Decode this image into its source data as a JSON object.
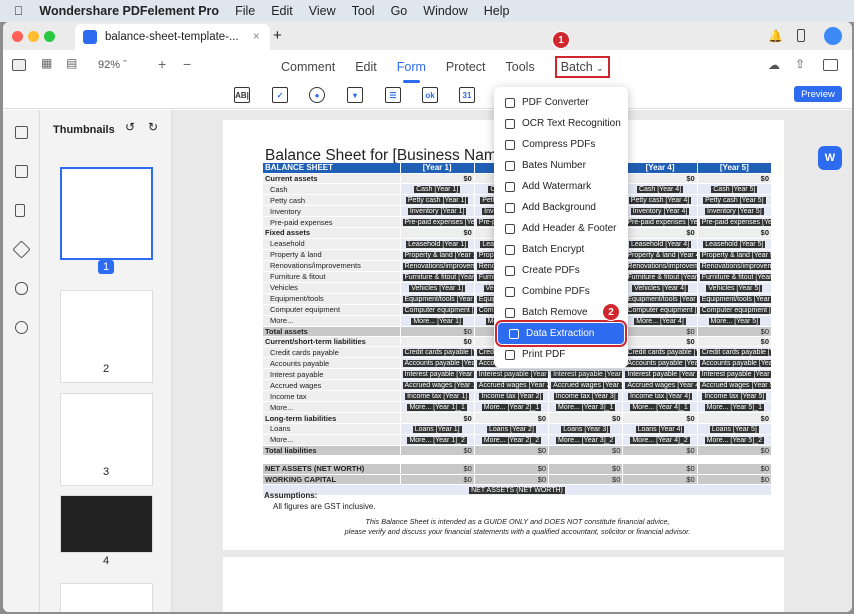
{
  "menubar": {
    "app": "Wondershare PDFelement Pro",
    "items": [
      "File",
      "Edit",
      "View",
      "Tool",
      "Go",
      "Window",
      "Help"
    ]
  },
  "tab": {
    "title": "balance-sheet-template-...",
    "close": "×",
    "new": "+"
  },
  "toolbar": {
    "zoom": "92%",
    "nav": [
      "Comment",
      "Edit",
      "Form",
      "Protect",
      "Tools"
    ],
    "batch": "Batch",
    "preview": "Preview",
    "form_tools": [
      "AB|",
      "✓",
      "●",
      "▾",
      "☰",
      "ok",
      "31"
    ]
  },
  "badges": [
    "1",
    "2"
  ],
  "thumbnails": {
    "title": "Thumbnails",
    "pages": [
      "1",
      "2",
      "3",
      "4"
    ]
  },
  "batch_menu": [
    "PDF Converter",
    "OCR Text Recognition",
    "Compress PDFs",
    "Bates Number",
    "Add Watermark",
    "Add Background",
    "Add Header & Footer",
    "Batch Encrypt",
    "Create PDFs",
    "Combine PDFs",
    "Batch Remove",
    "Data Extraction",
    "Print PDF"
  ],
  "selected_menu_item": "Data Extraction",
  "document": {
    "title": "Balance Sheet for [Business Name]",
    "headers": [
      "BALANCE SHEET",
      "[Year 1]",
      "[Year 2]",
      "[Year 3]",
      "[Year 4]",
      "[Year 5]"
    ],
    "rows": [
      {
        "t": "sec",
        "label": "Current assets",
        "v": "$0"
      },
      {
        "t": "item",
        "label": "Cash",
        "f": "Cash"
      },
      {
        "t": "item",
        "label": "Petty cash",
        "f": "Petty cash"
      },
      {
        "t": "item",
        "label": "Inventory",
        "f": "Inventory"
      },
      {
        "t": "item",
        "label": "Pre-paid expenses",
        "f": "Pre-paid expenses"
      },
      {
        "t": "sec",
        "label": "Fixed assets",
        "v": "$0"
      },
      {
        "t": "item",
        "label": "Leasehold",
        "f": "Leasehold"
      },
      {
        "t": "item",
        "label": "Property & land",
        "f": "Property & land"
      },
      {
        "t": "item",
        "label": "Renovations/improvements",
        "f": "Renovations/improvements"
      },
      {
        "t": "item",
        "label": "Furniture & fitout",
        "f": "Furniture & fitout"
      },
      {
        "t": "item",
        "label": "Vehicles",
        "f": "Vehicles"
      },
      {
        "t": "item",
        "label": "Equipment/tools",
        "f": "Equipment/tools"
      },
      {
        "t": "item",
        "label": "Computer equipment",
        "f": "Computer equipment"
      },
      {
        "t": "item",
        "label": "More...",
        "f": "More..."
      },
      {
        "t": "tot",
        "label": "Total assets",
        "v": "$0"
      },
      {
        "t": "sec",
        "label": "Current/short-term liabilities",
        "v": "$0"
      },
      {
        "t": "item",
        "label": "Credit cards payable",
        "f": "Credit cards payable"
      },
      {
        "t": "item",
        "label": "Accounts payable",
        "f": "Accounts payable"
      },
      {
        "t": "item",
        "label": "Interest payable",
        "f": "Interest payable"
      },
      {
        "t": "item",
        "label": "Accrued wages",
        "f": "Accrued wages"
      },
      {
        "t": "item",
        "label": "Income tax",
        "f": "Income tax"
      },
      {
        "t": "item",
        "label": "More...",
        "f": "More...",
        "s": "_1"
      },
      {
        "t": "sec",
        "label": "Long-term liabilities",
        "v": "$0"
      },
      {
        "t": "item",
        "label": "Loans",
        "f": "Loans"
      },
      {
        "t": "item",
        "label": "More...",
        "f": "More...",
        "s": "_2"
      },
      {
        "t": "tot",
        "label": "Total liabilities",
        "v": "$0"
      },
      {
        "t": "blank",
        "label": ""
      },
      {
        "t": "tot",
        "label": "NET ASSETS (NET WORTH)",
        "v": "$0"
      },
      {
        "t": "tot",
        "label": "WORKING CAPITAL",
        "v": "$0"
      }
    ],
    "note_field": "NET ASSETS (NET WORTH)",
    "assumptions_title": "Assumptions:",
    "assumptions": "All figures are GST inclusive.",
    "disclaimer_1": "This Balance Sheet is intended as a GUIDE ONLY and DOES NOT constitute financial advice,",
    "disclaimer_2": "please verify and discuss your financial statements with a qualified accountant, solicitor or financial advisor."
  }
}
